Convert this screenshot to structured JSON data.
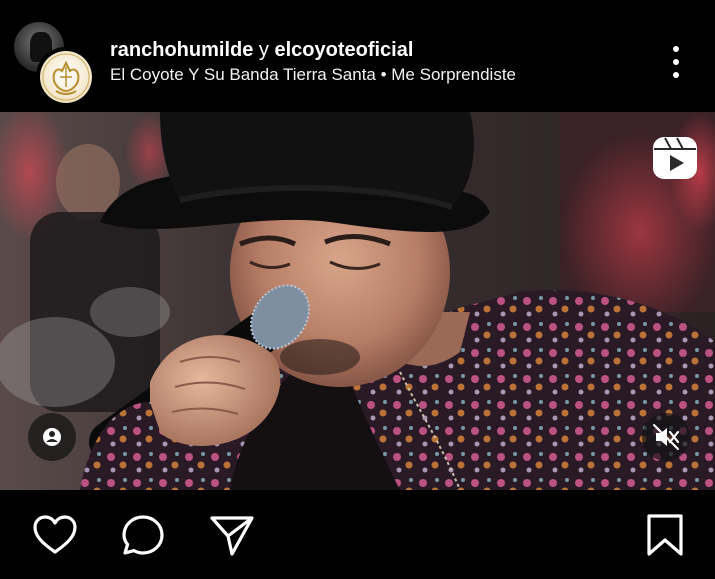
{
  "post": {
    "authors_primary": "ranchohumilde",
    "authors_joiner": " y ",
    "authors_secondary": "elcoyoteoficial",
    "audio": "El Coyote Y Su Banda Tierra Santa • Me Sorprendiste"
  },
  "icons": {
    "more": "more-vertical-icon",
    "reels": "reels-icon",
    "user_tag": "user-tag-icon",
    "mute": "volume-muted-icon",
    "like": "heart-icon",
    "comment": "comment-icon",
    "share": "send-icon",
    "save": "bookmark-icon"
  },
  "colors": {
    "background": "#000000",
    "foreground": "#ffffff"
  }
}
